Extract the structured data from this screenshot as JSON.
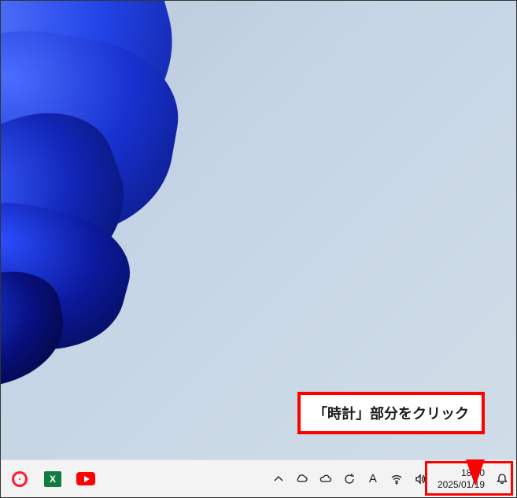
{
  "callout": {
    "text": "「時計」部分をクリック"
  },
  "taskbar": {
    "apps": {
      "opera": "Opera",
      "excel_label": "X",
      "youtube": "YouTube"
    },
    "tray": {
      "chevron": "Show hidden icons",
      "weather": "Weather",
      "onedrive": "OneDrive",
      "update": "Windows Update",
      "ime": "A",
      "wifi": "Wi-Fi",
      "volume": "Volume"
    },
    "clock": {
      "time": "18:20",
      "date": "2025/01/19"
    },
    "notifications": "Notifications"
  }
}
